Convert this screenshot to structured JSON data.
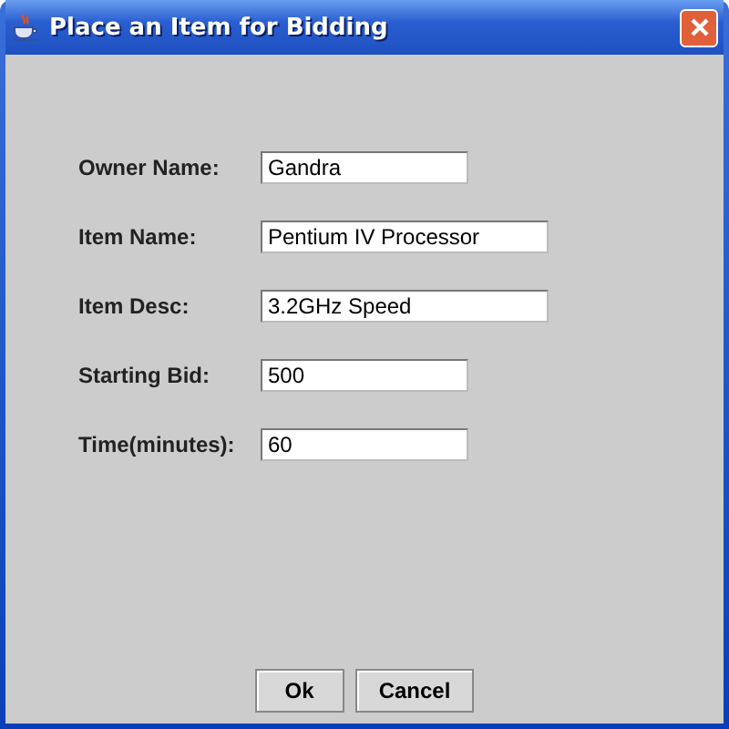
{
  "window": {
    "title": "Place an Item for Bidding"
  },
  "fields": [
    {
      "label": "Owner Name:",
      "value": "Gandra",
      "wide": false
    },
    {
      "label": "Item Name:",
      "value": "Pentium IV Processor",
      "wide": true
    },
    {
      "label": "Item Desc:",
      "value": "3.2GHz Speed",
      "wide": true
    },
    {
      "label": "Starting Bid:",
      "value": "500",
      "wide": false
    },
    {
      "label": "Time(minutes):",
      "value": "60",
      "wide": false
    }
  ],
  "buttons": [
    "Ok",
    "Cancel"
  ]
}
